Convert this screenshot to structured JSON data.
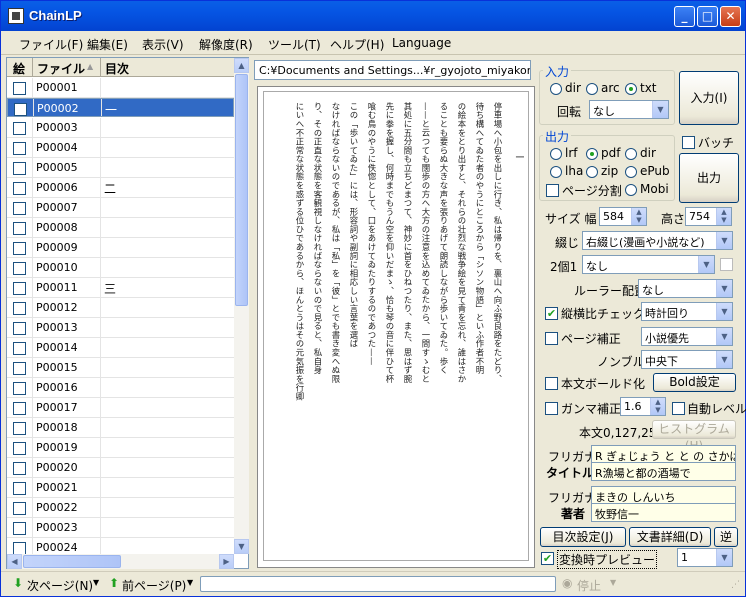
{
  "window": {
    "title": "ChainLP"
  },
  "menu": [
    "ファイル(F)",
    "編集(E)",
    "表示(V)",
    "解像度(R)",
    "ツール(T)",
    "ヘルプ(H)",
    "Language"
  ],
  "list": {
    "headers": {
      "pic": "絵",
      "file": "ファイル",
      "toc": "目次"
    },
    "rows": [
      {
        "file": "P00001",
        "toc": ""
      },
      {
        "file": "P00002",
        "toc": "一"
      },
      {
        "file": "P00003",
        "toc": ""
      },
      {
        "file": "P00004",
        "toc": ""
      },
      {
        "file": "P00005",
        "toc": ""
      },
      {
        "file": "P00006",
        "toc": "二"
      },
      {
        "file": "P00007",
        "toc": ""
      },
      {
        "file": "P00008",
        "toc": ""
      },
      {
        "file": "P00009",
        "toc": ""
      },
      {
        "file": "P00010",
        "toc": ""
      },
      {
        "file": "P00011",
        "toc": "三"
      },
      {
        "file": "P00012",
        "toc": ""
      },
      {
        "file": "P00013",
        "toc": ""
      },
      {
        "file": "P00014",
        "toc": ""
      },
      {
        "file": "P00015",
        "toc": ""
      },
      {
        "file": "P00016",
        "toc": ""
      },
      {
        "file": "P00017",
        "toc": ""
      },
      {
        "file": "P00018",
        "toc": ""
      },
      {
        "file": "P00019",
        "toc": ""
      },
      {
        "file": "P00020",
        "toc": ""
      },
      {
        "file": "P00021",
        "toc": ""
      },
      {
        "file": "P00022",
        "toc": ""
      },
      {
        "file": "P00023",
        "toc": ""
      },
      {
        "file": "P00024",
        "toc": ""
      }
    ],
    "selected_index": 1
  },
  "path": "C:¥Documents and Settings...¥r_gyojoto_miyakono.txt",
  "preview": {
    "chapter": "一",
    "columns": [
      "停車場へ小包を出しに行き、私は帰りを、裏山へ向ふ野良路をたどり、",
      "待ち構へてゐた者のやうにところから「シソン物語」といふ作者不明",
      "の絵本をとり出すと、それらの壮烈な戦争絵を見て青を忘れ、誰はさか",
      "ることも要らぬ大きな声を張りあげて朗読しながら歩いてゐた。歩く",
      "——と云つても闊歩の方へ大方の注意を込めてゐたから、一間すゝむと",
      "其処に五分間も立ちどまつて、神妙に首をひねつたり、また、思はず腕",
      "先に拳を握し、何時までもうん空を仰いだまゝ、恰も琴の音に伴ひて杯",
      "喰む鳥のやうに佚惚として、口をあけてゐたりするのであつた——",
      "この「歩いてゐた」には、形容詞や副詞に相応しい言葉を選ば",
      "なければならないのであるが、私は「私」を「彼」とでも書き変へぬ限",
      "り、その正直な状態を客観視しなければならないので見ると、私自身",
      "にいへ不正常な状態を惑ずる位ひであるから、ほんとうはその元気振を行卿"
    ]
  },
  "input": {
    "group": "入力",
    "radios": [
      "dir",
      "arc",
      "txt"
    ],
    "selected": "txt",
    "rotate_label": "回転",
    "rotate_value": "なし",
    "button": "入力(I)"
  },
  "output": {
    "group": "出力",
    "radios_row1": [
      "lrf",
      "pdf",
      "dir"
    ],
    "radios_row2": [
      "lha",
      "zip",
      "ePub"
    ],
    "page_split": "ページ分割",
    "mobi": "Mobi",
    "selected": "pdf",
    "batch": "バッチ",
    "button": "出力"
  },
  "size": {
    "label": "サイズ 幅",
    "width": "584",
    "height_label": "高さ",
    "height": "754"
  },
  "binding": {
    "label": "綴じ",
    "value": "右綴じ(漫画や小説など)"
  },
  "twoup": {
    "label": "2個1",
    "value": "なし"
  },
  "ruler": {
    "label": "ルーラー配置",
    "value": "なし"
  },
  "aspect": {
    "label": "縦横比チェック",
    "checked": true,
    "value": "時計回り"
  },
  "page_correct": {
    "label": "ページ補正",
    "checked": false,
    "value": "小説優先"
  },
  "nombre": {
    "label": "ノンブル",
    "value": "中央下"
  },
  "bold": {
    "label": "本文ボールド化",
    "button": "Bold設定"
  },
  "gamma": {
    "label": "ガンマ補正",
    "value": "1.6",
    "auto_level": "自動レベル"
  },
  "body_color": {
    "label": "本文0,127,255",
    "button": "ヒストグラム(H)"
  },
  "meta": {
    "furigana_label": "フリガナ",
    "title_label": "タイトル",
    "title_furigana": "R ぎょじょう と と の さかば で",
    "title": "R漁場と都の酒場で",
    "author_furigana_label": "フリガナ",
    "author_label": "著者",
    "author_furigana": "まきの しんいち",
    "author": "牧野信一"
  },
  "bottom_buttons": {
    "toc": "目次設定(J)",
    "doc": "文書詳細(D)",
    "reverse": "逆"
  },
  "convert_preview": {
    "label": "変換時プレビュー",
    "checked": true,
    "value": "1"
  },
  "status": {
    "next": "次ページ(N)",
    "prev": "前ページ(P)",
    "stop": "停止"
  }
}
